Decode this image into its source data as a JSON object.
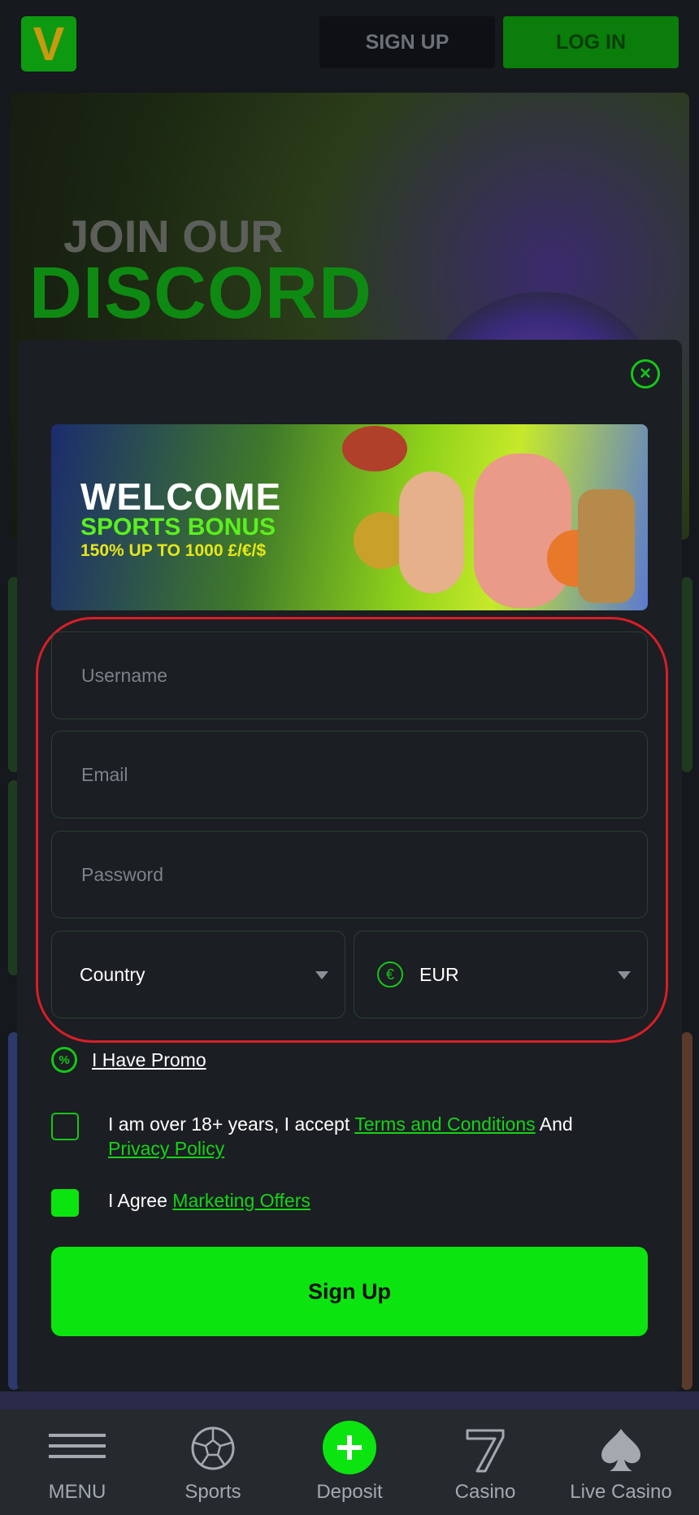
{
  "header": {
    "logo_letter": "V",
    "signup_label": "SIGN UP",
    "login_label": "LOG IN"
  },
  "background": {
    "join_text": "JOIN OUR",
    "discord_text": "DISCORD"
  },
  "promo_banner": {
    "line1": "WELCOME",
    "line2": "SPORTS BONUS",
    "line3": "150% UP TO 1000 £/€/$"
  },
  "form": {
    "username_placeholder": "Username",
    "email_placeholder": "Email",
    "password_placeholder": "Password",
    "country_value": "Country",
    "currency_value": "EUR",
    "currency_symbol": "€",
    "promo_icon_symbol": "%",
    "promo_label": "I Have Promo",
    "terms_prefix": "I am over 18+ years, I accept ",
    "terms_link": "Terms and Conditions",
    "terms_mid": " And ",
    "privacy_link": "Privacy Policy",
    "agree_prefix": "I Agree ",
    "marketing_link": "Marketing Offers",
    "terms_checked": false,
    "marketing_checked": true,
    "submit_label": "Sign Up"
  },
  "nav": {
    "items": [
      {
        "label": "MENU",
        "icon": "hamburger-icon"
      },
      {
        "label": "Sports",
        "icon": "soccer-ball-icon"
      },
      {
        "label": "Deposit",
        "icon": "plus-icon"
      },
      {
        "label": "Casino",
        "icon": "seven-icon"
      },
      {
        "label": "Live Casino",
        "icon": "spade-icon"
      }
    ]
  },
  "colors": {
    "accent": "#0ce40f",
    "highlight": "#d81e28",
    "modal_bg": "#1b1e22"
  }
}
